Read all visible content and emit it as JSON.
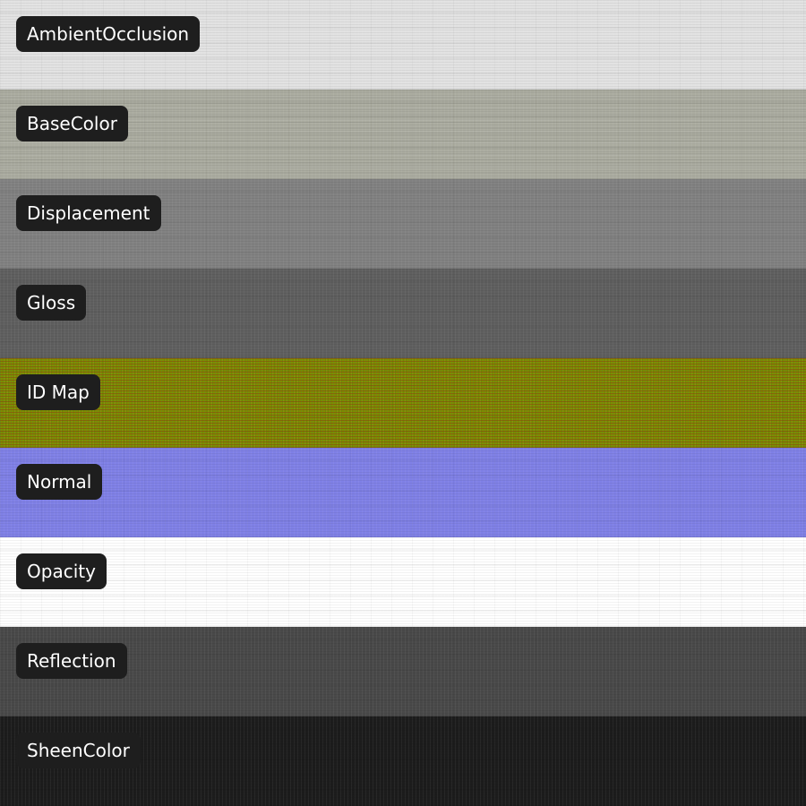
{
  "strips": [
    {
      "label": "AmbientOcclusion",
      "color": "#e2e2e2",
      "texture": "linen"
    },
    {
      "label": "BaseColor",
      "color": "#abaca0",
      "texture": "streaky"
    },
    {
      "label": "Displacement",
      "color": "#818181",
      "texture": "linen"
    },
    {
      "label": "Gloss",
      "color": "#5f5f5f",
      "texture": "linen"
    },
    {
      "label": "ID Map",
      "color": "#7f8c02",
      "texture": "idmap"
    },
    {
      "label": "Normal",
      "color": "#7f80e6",
      "texture": "linen"
    },
    {
      "label": "Opacity",
      "color": "#ffffff",
      "texture": "plain"
    },
    {
      "label": "Reflection",
      "color": "#494949",
      "texture": "linen"
    },
    {
      "label": "SheenColor",
      "color": "#1c1c1c",
      "texture": "linen"
    }
  ]
}
